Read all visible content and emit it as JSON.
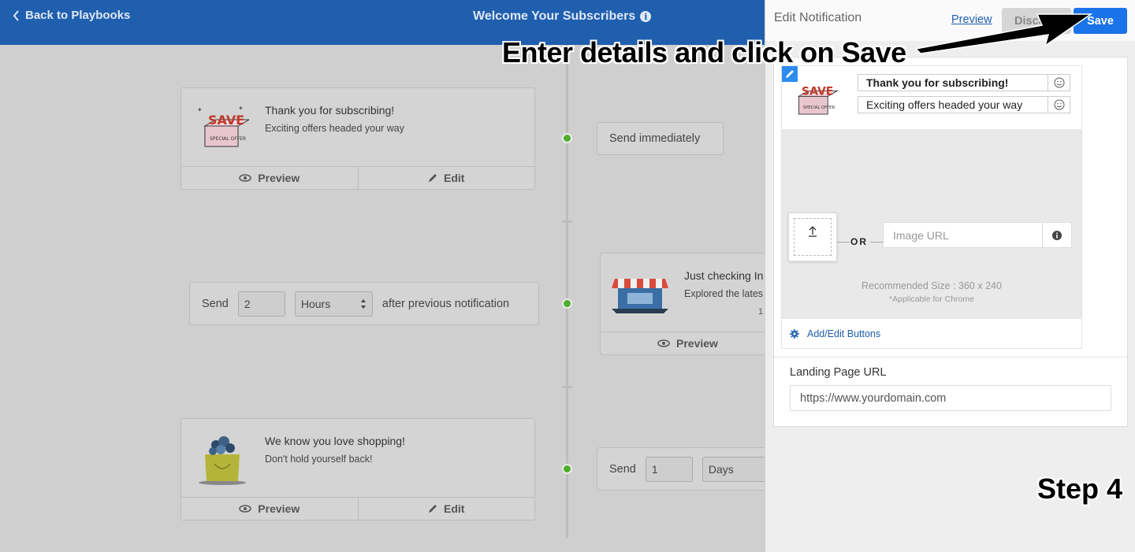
{
  "header": {
    "back_label": "Back to Playbooks",
    "title": "Welcome Your Subscribers"
  },
  "timeline": {
    "notification1": {
      "title": "Thank you for subscribing!",
      "message": "Exciting offers headed your way",
      "preview_label": "Preview",
      "edit_label": "Edit"
    },
    "send_immediately": "Send immediately",
    "delay1": {
      "send_label": "Send",
      "value": "2",
      "unit": "Hours",
      "suffix": "after previous notification"
    },
    "notification2": {
      "title": "Just checking In",
      "message": "Explored the lates",
      "extra": "1",
      "preview_label": "Preview"
    },
    "notification3": {
      "title": "We know you love shopping!",
      "message": "Don't hold yourself back!",
      "preview_label": "Preview",
      "edit_label": "Edit"
    },
    "delay2": {
      "send_label": "Send",
      "value": "1",
      "unit": "Days"
    }
  },
  "panel": {
    "title": "Edit Notification",
    "preview_link": "Preview",
    "discard_label": "Discard",
    "save_label": "Save",
    "title_field": "Thank you for subscribing!",
    "message_field": "Exciting offers headed your way",
    "or_label": "OR",
    "image_url_placeholder": "Image URL",
    "recommended_size": "Recommended Size : 360 x 240",
    "applicable_note": "*Applicable for Chrome",
    "add_edit_buttons": "Add/Edit Buttons",
    "landing_label": "Landing Page URL",
    "landing_placeholder": "https://www.yourdomain.com"
  },
  "annotations": {
    "instruction": "Enter details and click on Save",
    "step": "Step 4"
  },
  "icons": [
    "chevron-left-icon",
    "info-icon",
    "eye-icon",
    "pencil-icon",
    "select-arrows-icon",
    "smiley-icon",
    "upload-icon",
    "gear-icon"
  ],
  "colors": {
    "header_bg": "#1f5fae",
    "save_bg": "#1a73e8",
    "timeline_dot": "#4caf2a"
  }
}
